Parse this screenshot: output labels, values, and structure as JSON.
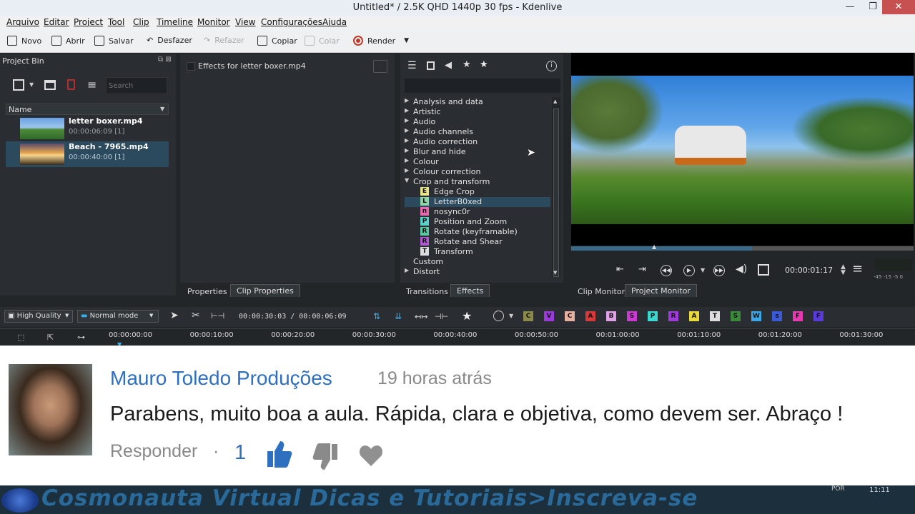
{
  "window": {
    "title": "Untitled* / 2.5K QHD 1440p 30 fps - Kdenlive",
    "controls": [
      "—",
      "❐",
      "✕"
    ]
  },
  "menu": [
    "Arquivo",
    "Editar",
    "Project",
    "Tool",
    "Clip",
    "Timeline",
    "Monitor",
    "View",
    "Configurações",
    "Ajuda"
  ],
  "toolbar": {
    "novo": "Novo",
    "abrir": "Abrir",
    "salvar": "Salvar",
    "desfazer": "Desfazer",
    "refazer": "Refazer",
    "copiar": "Copiar",
    "colar": "Colar",
    "render": "Render"
  },
  "bin": {
    "title": "Project Bin",
    "search_placeholder": "Search",
    "column": "Name",
    "clips": [
      {
        "name": "letter boxer.mp4",
        "duration": "00:00:06:09",
        "count": "[1]"
      },
      {
        "name": "Beach - 7965.mp4",
        "duration": "00:00:40:00",
        "count": "[1]"
      }
    ]
  },
  "effects_stack": {
    "title": "Effects for letter boxer.mp4"
  },
  "effects_tree": {
    "categories": [
      "Analysis and data",
      "Artistic",
      "Audio",
      "Audio channels",
      "Audio correction",
      "Blur and hide",
      "Colour",
      "Colour correction",
      "Crop and transform"
    ],
    "crop_items": [
      {
        "letter": "E",
        "name": "Edge Crop",
        "color": "#e8e48a"
      },
      {
        "letter": "L",
        "name": "LetterB0xed",
        "color": "#8fd6a8"
      },
      {
        "letter": "n",
        "name": "nosync0r",
        "color": "#e86ab0"
      },
      {
        "letter": "P",
        "name": "Position and Zoom",
        "color": "#5ad0c8"
      },
      {
        "letter": "R",
        "name": "Rotate (keyframable)",
        "color": "#5ac8a0"
      },
      {
        "letter": "R",
        "name": "Rotate and Shear",
        "color": "#b05ad0"
      },
      {
        "letter": "T",
        "name": "Transform",
        "color": "#dddddd"
      }
    ],
    "after": [
      "Custom",
      "Distort"
    ]
  },
  "tabs": {
    "properties": "Properties",
    "clip_properties": "Clip Properties",
    "transitions": "Transitions",
    "effects": "Effects",
    "clip_monitor": "Clip Monitor",
    "project_monitor": "Project Monitor"
  },
  "monitor": {
    "timecode": "00:00:01:17",
    "audio_scale": "-45 -15 -5 0"
  },
  "timeline_toolbar": {
    "quality": "High Quality",
    "mode": "Normal mode",
    "position": "00:00:30:03 / 00:00:06:09",
    "tags": [
      {
        "l": "C",
        "c": "#8a8a4a"
      },
      {
        "l": "V",
        "c": "#9a3ad8"
      },
      {
        "l": "C",
        "c": "#e8b0a0"
      },
      {
        "l": "A",
        "c": "#d83a3a"
      },
      {
        "l": "B",
        "c": "#e0a0e8"
      },
      {
        "l": "S",
        "c": "#c83ad0"
      },
      {
        "l": "P",
        "c": "#3ad8d0"
      },
      {
        "l": "R",
        "c": "#a03ad8"
      },
      {
        "l": "A",
        "c": "#e8d83a"
      },
      {
        "l": "T",
        "c": "#dddddd"
      },
      {
        "l": "S",
        "c": "#3a8a3a"
      },
      {
        "l": "W",
        "c": "#3aa8e8"
      },
      {
        "l": "s",
        "c": "#3a5ad8"
      },
      {
        "l": "F",
        "c": "#e83ab0"
      },
      {
        "l": "F",
        "c": "#5a3ad8"
      }
    ]
  },
  "ruler": [
    "00:00:00:00",
    "00:00:10:00",
    "00:00:20:00",
    "00:00:30:00",
    "00:00:40:00",
    "00:00:50:00",
    "00:01:00:00",
    "00:01:10:00",
    "00:01:20:00",
    "00:01:30:00"
  ],
  "comment": {
    "author": "Mauro Toledo Produções",
    "time": "19 horas atrás",
    "text": "Parabens, muito boa a aula. Rápida, clara e objetiva, como devem ser. Abraço !",
    "reply": "Responder",
    "sep": "·",
    "likes": "1"
  },
  "banner": {
    "text": "Cosmonauta Virtual Dicas e Tutoriais>Inscreva-se",
    "clock": "11:11",
    "lang": "POR"
  },
  "colors": {
    "accent": "#3daee9",
    "selection": "#2c4a5e",
    "link": "#2f6fbf"
  }
}
